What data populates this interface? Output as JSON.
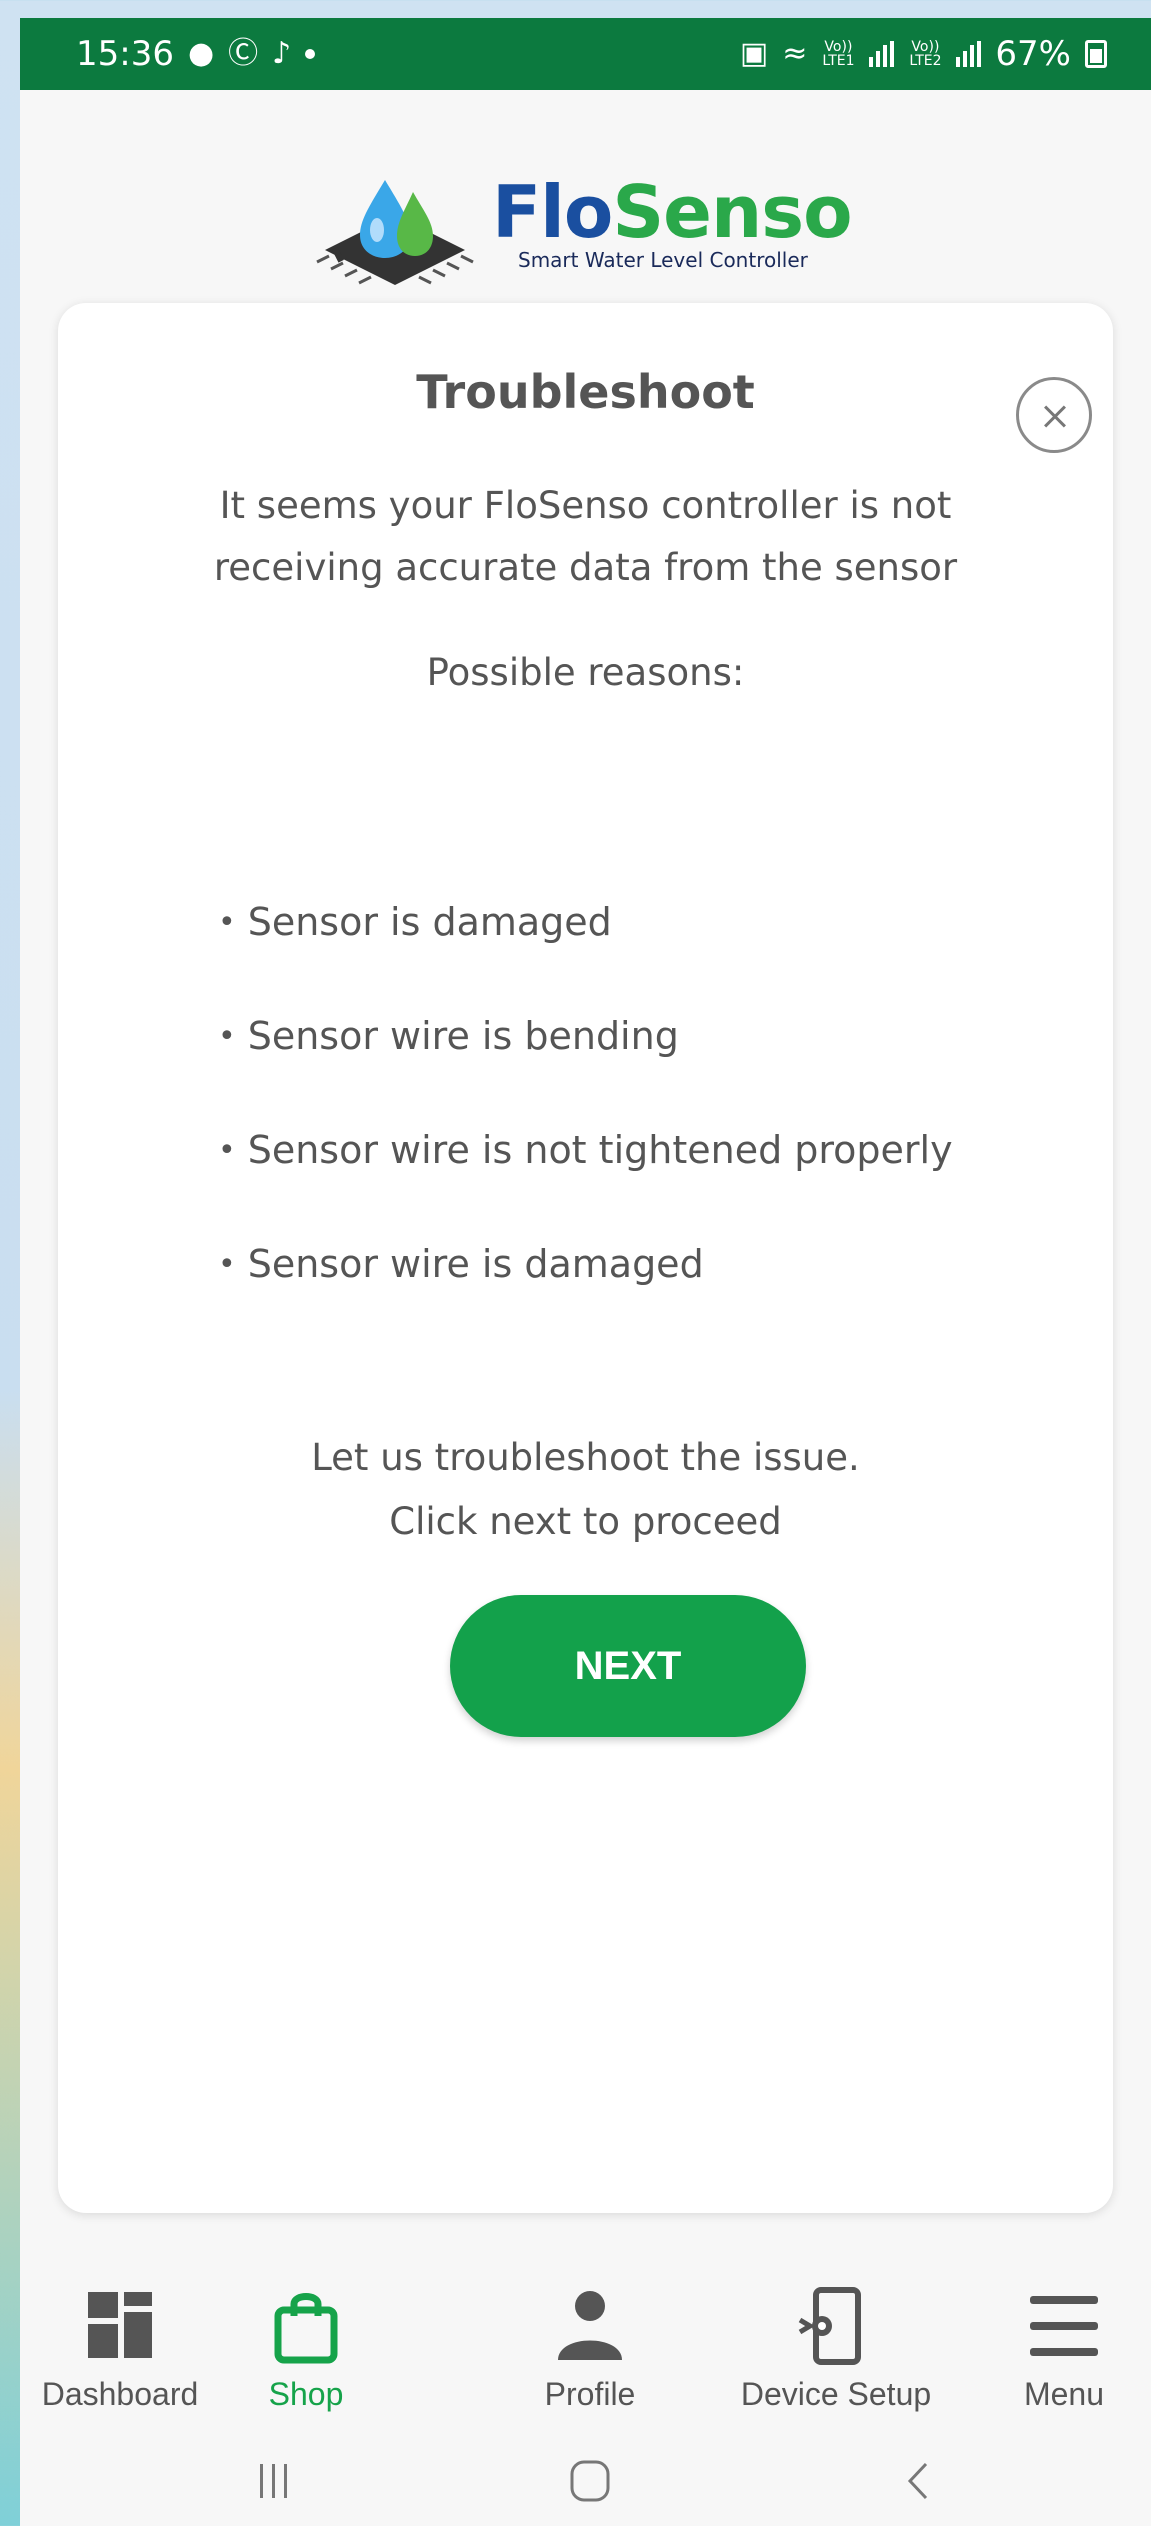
{
  "status_bar": {
    "time": "15:36",
    "battery": "67%",
    "sim1_label": "Vo)) LTE1",
    "sim2_label": "Vo)) LTE2"
  },
  "brand": {
    "name_part1": "Flo",
    "name_part2": "Senso",
    "tagline": "Smart Water Level Controller",
    "colors": {
      "flo": "#1a4fa0",
      "senso": "#2aa84a"
    }
  },
  "dialog": {
    "title": "Troubleshoot",
    "intro_line1": "It seems your FloSenso controller is not",
    "intro_line2": "receiving accurate data from the sensor",
    "reasons_title": "Possible reasons:",
    "reasons": [
      "Sensor is damaged",
      "Sensor wire is bending",
      "Sensor wire is not tightened properly",
      "Sensor wire is damaged"
    ],
    "outro_line1": "Let us troubleshoot the issue.",
    "outro_line2": "Click next to proceed",
    "next_label": "NEXT"
  },
  "bottom_nav": {
    "items": [
      {
        "label": "Dashboard",
        "icon": "dashboard-icon",
        "active": false
      },
      {
        "label": "Shop",
        "icon": "shopping-bag-icon",
        "active": true
      },
      {
        "label": "Profile",
        "icon": "person-icon",
        "active": false
      },
      {
        "label": "Device Setup",
        "icon": "device-setup-icon",
        "active": false
      },
      {
        "label": "Menu",
        "icon": "hamburger-menu-icon",
        "active": false
      }
    ]
  },
  "system_nav": [
    "recent-apps-icon",
    "home-icon",
    "back-icon"
  ],
  "theme": {
    "accent": "#13a14b",
    "status_bar": "#0c7a3f"
  }
}
